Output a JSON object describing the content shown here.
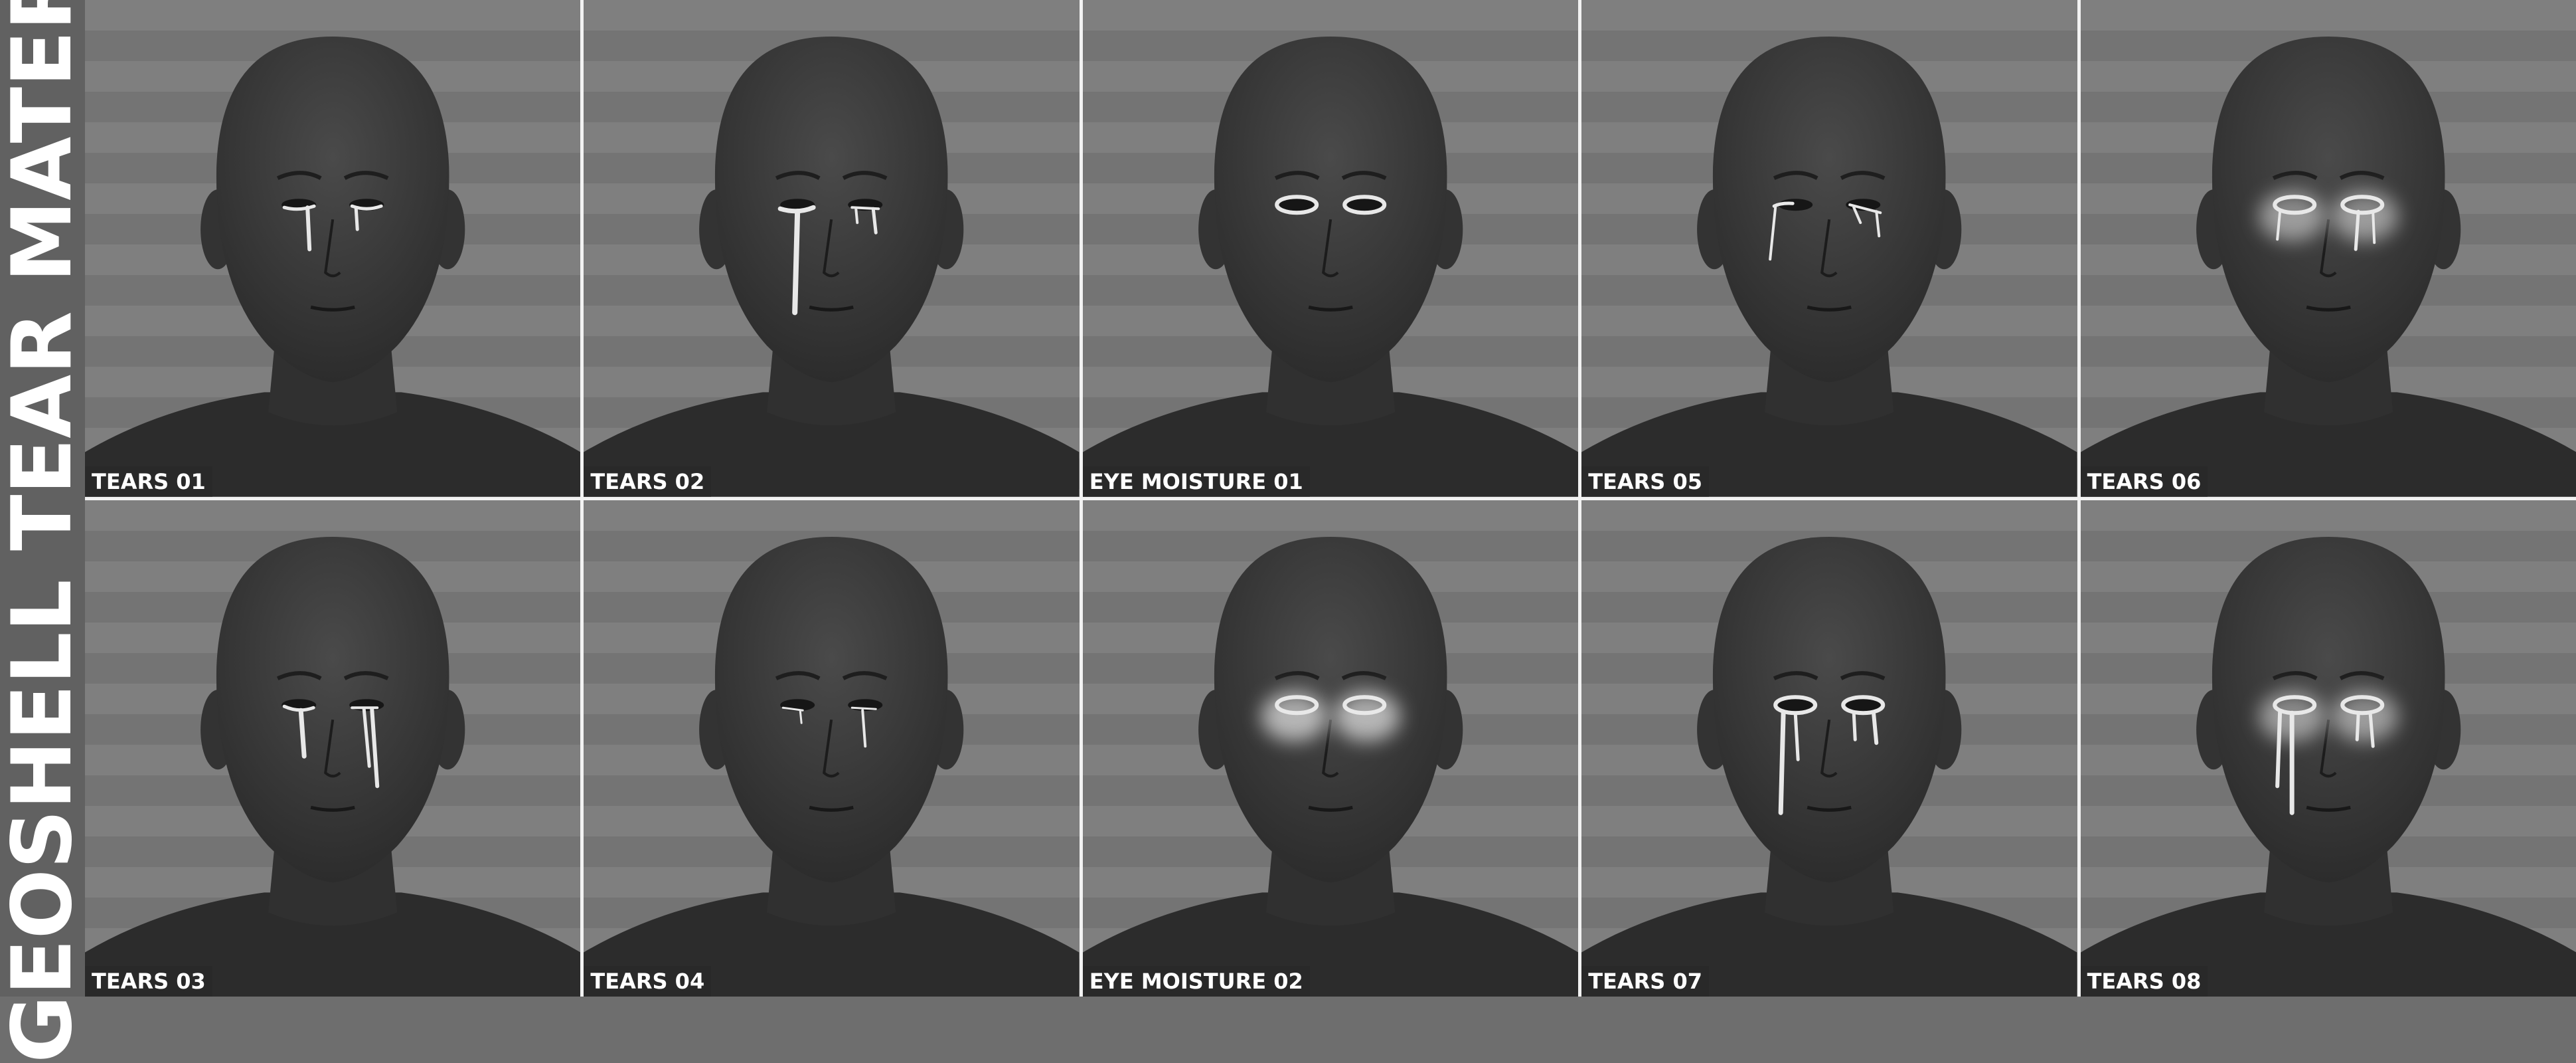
{
  "title": "GEOSHELL TEAR MATERIALS",
  "panels": [
    {
      "label": "TEARS 01",
      "effect": "tears-short"
    },
    {
      "label": "TEARS 02",
      "effect": "tears-long-single"
    },
    {
      "label": "EYE MOISTURE 01",
      "effect": "moisture-rim"
    },
    {
      "label": "TEARS 05",
      "effect": "tears-streaks"
    },
    {
      "label": "TEARS 06",
      "effect": "tears-glow-short"
    },
    {
      "label": "TEARS 03",
      "effect": "tears-double"
    },
    {
      "label": "TEARS 04",
      "effect": "tears-thin"
    },
    {
      "label": "EYE MOISTURE 02",
      "effect": "moisture-glow"
    },
    {
      "label": "TEARS 07",
      "effect": "tears-heavy"
    },
    {
      "label": "TEARS 08",
      "effect": "tears-glow-long"
    }
  ],
  "colors": {
    "background": "#7f7f7f",
    "skin": "#2c2c2c",
    "tear": "#e8e8e8",
    "label_text": "#ffffff"
  }
}
